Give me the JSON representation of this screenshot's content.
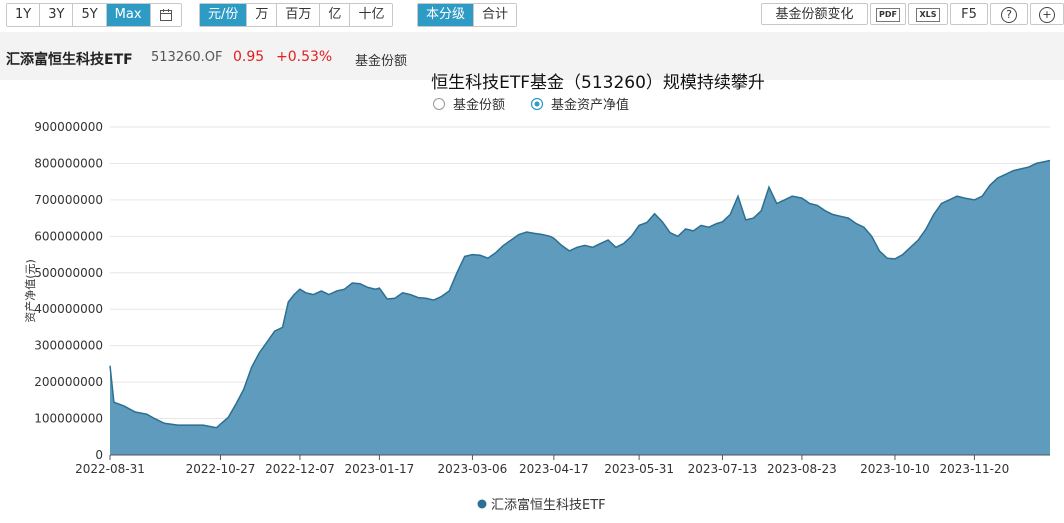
{
  "toolbar": {
    "range_buttons": [
      "1Y",
      "3Y",
      "5Y",
      "Max"
    ],
    "range_active": "Max",
    "unit_buttons": [
      "元/份",
      "万",
      "百万",
      "亿",
      "十亿"
    ],
    "unit_active": "元/份",
    "scope_buttons": [
      "本分级",
      "合计"
    ],
    "scope_active": "本分级",
    "share_change_label": "基金份额变化",
    "pdf_label": "PDF",
    "xls_label": "XLS",
    "f5_label": "F5",
    "help_icon_glyph": "?",
    "add_icon_glyph": "+",
    "accent_color": "#2e9bc4"
  },
  "info": {
    "fund_name": "汇添富恒生科技ETF",
    "fund_code": "513260.OF",
    "price": "0.95",
    "change": "+0.53%",
    "metric": "基金份额",
    "up_color": "#e02020"
  },
  "selector": {
    "options": [
      "基金份额",
      "基金资产净值"
    ],
    "selected": "基金资产净值"
  },
  "chart_data": {
    "type": "area",
    "title": "恒生科技ETF基金（513260）规模持续攀升",
    "ylabel": "资产净值(元)",
    "xlabel": "",
    "ylim": [
      0,
      900000000
    ],
    "yticks": [
      "0",
      "100000000",
      "200000000",
      "300000000",
      "400000000",
      "500000000",
      "600000000",
      "700000000",
      "800000000",
      "900000000"
    ],
    "xtick_labels": [
      "2022-08-31",
      "2022-10-27",
      "2022-12-07",
      "2023-01-17",
      "2023-03-06",
      "2023-04-17",
      "2023-05-31",
      "2023-07-13",
      "2023-08-23",
      "2023-10-10",
      "2023-11-20"
    ],
    "x_start": "2022-08-31",
    "x_end": "2023-12-29",
    "grid": "horizontal",
    "legend_position": "bottom",
    "series": [
      {
        "name": "汇添富恒生科技ETF",
        "color": "#2c6f92",
        "fill": "#5f9bbc",
        "points": [
          [
            "2022-08-31",
            245000000
          ],
          [
            "2022-09-02",
            145000000
          ],
          [
            "2022-09-07",
            135000000
          ],
          [
            "2022-09-13",
            118000000
          ],
          [
            "2022-09-19",
            112000000
          ],
          [
            "2022-09-23",
            100000000
          ],
          [
            "2022-09-28",
            87000000
          ],
          [
            "2022-10-05",
            82000000
          ],
          [
            "2022-10-12",
            82000000
          ],
          [
            "2022-10-18",
            82000000
          ],
          [
            "2022-10-25",
            75000000
          ],
          [
            "2022-10-27",
            85000000
          ],
          [
            "2022-10-31",
            103000000
          ],
          [
            "2022-11-04",
            140000000
          ],
          [
            "2022-11-08",
            180000000
          ],
          [
            "2022-11-12",
            240000000
          ],
          [
            "2022-11-16",
            280000000
          ],
          [
            "2022-11-20",
            310000000
          ],
          [
            "2022-11-24",
            340000000
          ],
          [
            "2022-11-28",
            350000000
          ],
          [
            "2022-12-01",
            420000000
          ],
          [
            "2022-12-04",
            440000000
          ],
          [
            "2022-12-07",
            455000000
          ],
          [
            "2022-12-10",
            445000000
          ],
          [
            "2022-12-14",
            440000000
          ],
          [
            "2022-12-18",
            450000000
          ],
          [
            "2022-12-22",
            440000000
          ],
          [
            "2022-12-26",
            450000000
          ],
          [
            "2022-12-30",
            455000000
          ],
          [
            "2023-01-03",
            472000000
          ],
          [
            "2023-01-07",
            470000000
          ],
          [
            "2023-01-11",
            460000000
          ],
          [
            "2023-01-15",
            455000000
          ],
          [
            "2023-01-17",
            458000000
          ],
          [
            "2023-01-21",
            428000000
          ],
          [
            "2023-01-25",
            430000000
          ],
          [
            "2023-01-29",
            445000000
          ],
          [
            "2023-02-02",
            440000000
          ],
          [
            "2023-02-06",
            432000000
          ],
          [
            "2023-02-10",
            430000000
          ],
          [
            "2023-02-14",
            425000000
          ],
          [
            "2023-02-18",
            435000000
          ],
          [
            "2023-02-22",
            450000000
          ],
          [
            "2023-02-26",
            500000000
          ],
          [
            "2023-03-02",
            545000000
          ],
          [
            "2023-03-06",
            550000000
          ],
          [
            "2023-03-10",
            548000000
          ],
          [
            "2023-03-14",
            540000000
          ],
          [
            "2023-03-18",
            555000000
          ],
          [
            "2023-03-22",
            575000000
          ],
          [
            "2023-03-26",
            590000000
          ],
          [
            "2023-03-30",
            605000000
          ],
          [
            "2023-04-03",
            612000000
          ],
          [
            "2023-04-07",
            608000000
          ],
          [
            "2023-04-11",
            605000000
          ],
          [
            "2023-04-15",
            600000000
          ],
          [
            "2023-04-17",
            595000000
          ],
          [
            "2023-04-21",
            575000000
          ],
          [
            "2023-04-25",
            560000000
          ],
          [
            "2023-04-29",
            570000000
          ],
          [
            "2023-05-03",
            575000000
          ],
          [
            "2023-05-07",
            570000000
          ],
          [
            "2023-05-11",
            580000000
          ],
          [
            "2023-05-15",
            590000000
          ],
          [
            "2023-05-19",
            570000000
          ],
          [
            "2023-05-23",
            580000000
          ],
          [
            "2023-05-27",
            600000000
          ],
          [
            "2023-05-31",
            630000000
          ],
          [
            "2023-06-04",
            638000000
          ],
          [
            "2023-06-08",
            662000000
          ],
          [
            "2023-06-12",
            640000000
          ],
          [
            "2023-06-16",
            610000000
          ],
          [
            "2023-06-20",
            600000000
          ],
          [
            "2023-06-24",
            620000000
          ],
          [
            "2023-06-28",
            615000000
          ],
          [
            "2023-07-02",
            630000000
          ],
          [
            "2023-07-06",
            625000000
          ],
          [
            "2023-07-10",
            635000000
          ],
          [
            "2023-07-13",
            640000000
          ],
          [
            "2023-07-17",
            660000000
          ],
          [
            "2023-07-21",
            710000000
          ],
          [
            "2023-07-25",
            645000000
          ],
          [
            "2023-07-29",
            650000000
          ],
          [
            "2023-08-02",
            670000000
          ],
          [
            "2023-08-06",
            735000000
          ],
          [
            "2023-08-10",
            690000000
          ],
          [
            "2023-08-14",
            700000000
          ],
          [
            "2023-08-18",
            710000000
          ],
          [
            "2023-08-23",
            705000000
          ],
          [
            "2023-08-27",
            690000000
          ],
          [
            "2023-08-31",
            685000000
          ],
          [
            "2023-09-04",
            670000000
          ],
          [
            "2023-09-08",
            660000000
          ],
          [
            "2023-09-12",
            655000000
          ],
          [
            "2023-09-16",
            650000000
          ],
          [
            "2023-09-20",
            635000000
          ],
          [
            "2023-09-24",
            625000000
          ],
          [
            "2023-09-28",
            600000000
          ],
          [
            "2023-10-02",
            560000000
          ],
          [
            "2023-10-06",
            540000000
          ],
          [
            "2023-10-10",
            538000000
          ],
          [
            "2023-10-14",
            550000000
          ],
          [
            "2023-10-18",
            570000000
          ],
          [
            "2023-10-22",
            590000000
          ],
          [
            "2023-10-26",
            620000000
          ],
          [
            "2023-10-30",
            660000000
          ],
          [
            "2023-11-03",
            690000000
          ],
          [
            "2023-11-07",
            700000000
          ],
          [
            "2023-11-11",
            710000000
          ],
          [
            "2023-11-15",
            705000000
          ],
          [
            "2023-11-20",
            700000000
          ],
          [
            "2023-11-24",
            710000000
          ],
          [
            "2023-11-28",
            740000000
          ],
          [
            "2023-12-02",
            760000000
          ],
          [
            "2023-12-06",
            770000000
          ],
          [
            "2023-12-10",
            780000000
          ],
          [
            "2023-12-14",
            785000000
          ],
          [
            "2023-12-18",
            790000000
          ],
          [
            "2023-12-22",
            800000000
          ],
          [
            "2023-12-29",
            808000000
          ]
        ]
      }
    ]
  }
}
